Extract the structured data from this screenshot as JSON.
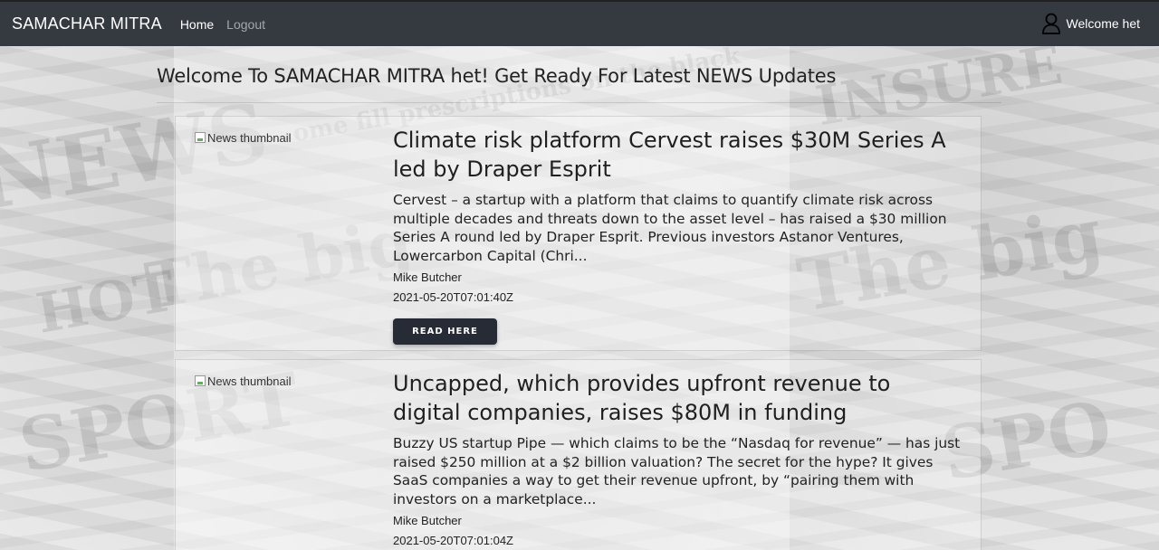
{
  "navbar": {
    "brand": "SAMACHAR MITRA",
    "links": [
      {
        "label": "Home"
      },
      {
        "label": "Logout"
      }
    ],
    "welcome_text": "Welcome het",
    "user_icon": "user-icon"
  },
  "page": {
    "heading": "Welcome To SAMACHAR MITRA het! Get Ready For Latest NEWS Updates"
  },
  "articles": [
    {
      "thumbnail_alt": "News thumbnail",
      "title": "Climate risk platform Cervest raises $30M Series A led by Draper Esprit",
      "description": "Cervest – a startup with a platform that claims to quantify climate risk across multiple decades and threats down to the asset level – has raised a $30 million Series A round led by Draper Esprit. Previous investors Astanor Ventures, Lowercarbon Capital (Chri...",
      "author": "Mike Butcher",
      "date": "2021-05-20T07:01:40Z",
      "button_label": "READ HERE"
    },
    {
      "thumbnail_alt": "News thumbnail",
      "title": "Uncapped, which provides upfront revenue to digital companies, raises $80M in funding",
      "description": "Buzzy US startup Pipe — which claims to be the “Nasdaq for revenue” — has just raised $250 million at a $2 billion valuation? The secret for the hype? It gives SaaS companies a way to get their revenue upfront, by “pairing them with investors on a marketplace...",
      "author": "Mike Butcher",
      "date": "2021-05-20T07:01:04Z"
    }
  ]
}
